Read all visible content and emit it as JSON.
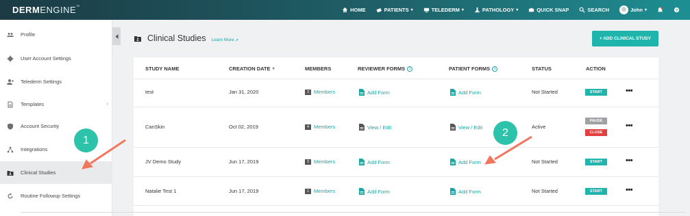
{
  "app": {
    "logo_bold": "DERM",
    "logo_light": "ENGINE",
    "logo_tm": "™"
  },
  "nav": {
    "items": [
      {
        "label": "HOME",
        "icon": "home-icon"
      },
      {
        "label": "PATIENTS",
        "icon": "patients-icon",
        "dropdown": true
      },
      {
        "label": "TELEDERM",
        "icon": "telederm-icon",
        "dropdown": true
      },
      {
        "label": "PATHOLOGY",
        "icon": "pathology-icon",
        "dropdown": true
      },
      {
        "label": "QUICK SNAP",
        "icon": "camera-icon"
      },
      {
        "label": "SEARCH",
        "icon": "search-icon"
      }
    ],
    "user": "John"
  },
  "sidebar": {
    "items": [
      {
        "label": "Profile",
        "icon": "people-icon"
      },
      {
        "label": "User Account Settings",
        "icon": "gear-icon"
      },
      {
        "label": "Telederm Settings",
        "icon": "user-settings-icon"
      },
      {
        "label": "Templates",
        "icon": "document-icon",
        "chevron": "‹"
      },
      {
        "label": "Account Security",
        "icon": "shield-icon"
      },
      {
        "label": "Integrations",
        "icon": "integrations-icon"
      },
      {
        "label": "Clinical Studies",
        "icon": "folder-user-icon",
        "active": true
      },
      {
        "label": "Routine Followup Settings",
        "icon": "refresh-icon"
      }
    ]
  },
  "page": {
    "title": "Clinical Studies",
    "learn_more": "Learn More",
    "add_button": "+ ADD CLINICAL STUDY"
  },
  "table": {
    "headers": {
      "name": "STUDY NAME",
      "date": "CREATION DATE",
      "date_sort": "▾",
      "members": "MEMBERS",
      "reviewer": "REVIEWER FORMS",
      "patient": "PATIENT FORMS",
      "status": "STATUS",
      "action": "ACTION"
    },
    "info_glyph": "i",
    "more_glyph": "•••",
    "rows": [
      {
        "name": "test",
        "date": "Jan 31, 2020",
        "members_count": "3",
        "members_label": "Members",
        "reviewer": "Add Form",
        "patient": "Add Form",
        "status": "Not Started",
        "actions": [
          "START"
        ]
      },
      {
        "name": "CanSkin",
        "date": "Oct 02, 2019",
        "members_count": "4",
        "members_label": "Members",
        "reviewer": "View / Edit",
        "patient": "View / Edit",
        "status": "Active",
        "actions": [
          "PAUSE",
          "CLOSE"
        ]
      },
      {
        "name": "JV Demo Study",
        "date": "Jun 17, 2019",
        "members_count": "3",
        "members_label": "Members",
        "reviewer": "Add Form",
        "patient": "Add Form",
        "status": "Not Started",
        "actions": [
          "START"
        ]
      },
      {
        "name": "Natalie Test 1",
        "date": "Jun 17, 2019",
        "members_count": "1",
        "members_label": "Members",
        "reviewer": "Add Form",
        "patient": "Add Form",
        "status": "Not Started",
        "actions": [
          "START"
        ]
      }
    ]
  },
  "annotations": {
    "marker_1": "1",
    "marker_2": "2"
  },
  "colors": {
    "accent": "#1fb5ad",
    "link": "#19a7a5",
    "close": "#e53e3e",
    "pause": "#9ea2a5",
    "arrow": "#f0765e",
    "marker": "#2dc3aa"
  }
}
